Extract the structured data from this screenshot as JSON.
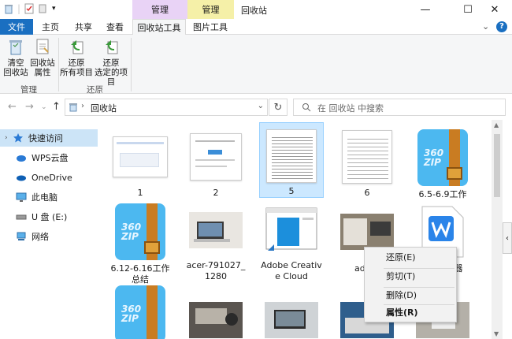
{
  "window": {
    "title": "回收站",
    "context_group_1": "管理",
    "context_group_2": "管理",
    "minimize": "—",
    "maximize": "☐",
    "close": "✕"
  },
  "ribbon_tabs": {
    "file": "文件",
    "home": "主页",
    "share": "共享",
    "view": "查看",
    "recycle_tools": "回收站工具",
    "picture_tools": "图片工具"
  },
  "ribbon": {
    "empty_label": "清空\n回收站",
    "empty_l1": "清空",
    "empty_l2": "回收站",
    "props_l1": "回收站",
    "props_l2": "属性",
    "restore_all_l1": "还原",
    "restore_all_l2": "所有项目",
    "restore_sel_l1": "还原",
    "restore_sel_l2": "选定的项目",
    "group_manage": "管理",
    "group_restore": "还原"
  },
  "address": {
    "path": "回收站",
    "search_placeholder": "在 回收站 中搜索"
  },
  "nav": {
    "items": [
      {
        "label": "快速访问"
      },
      {
        "label": "WPS云盘"
      },
      {
        "label": "OneDrive"
      },
      {
        "label": "此电脑"
      },
      {
        "label": "U 盘 (E:)"
      },
      {
        "label": "网络"
      }
    ]
  },
  "files": [
    {
      "name": "1"
    },
    {
      "name": "2"
    },
    {
      "name": "5"
    },
    {
      "name": "6"
    },
    {
      "name": "6.5-6.9工作"
    },
    {
      "name": "6.12-6.16工作总结"
    },
    {
      "name": "acer-791027_1280"
    },
    {
      "name": "Adobe Creative Cloud"
    },
    {
      "name": "adult-"
    },
    {
      "name": "器"
    }
  ],
  "context_menu": {
    "restore": "还原(E)",
    "cut": "剪切(T)",
    "delete": "删除(D)",
    "properties": "属性(R)"
  },
  "zip_badge": "360\nZIP",
  "zip_l1": "360",
  "zip_l2": "ZIP",
  "colors": {
    "accent": "#1a6fc1",
    "selection": "#cce8ff",
    "manage_purple": "#e9d3f6",
    "manage_yellow": "#f5f0a8"
  }
}
